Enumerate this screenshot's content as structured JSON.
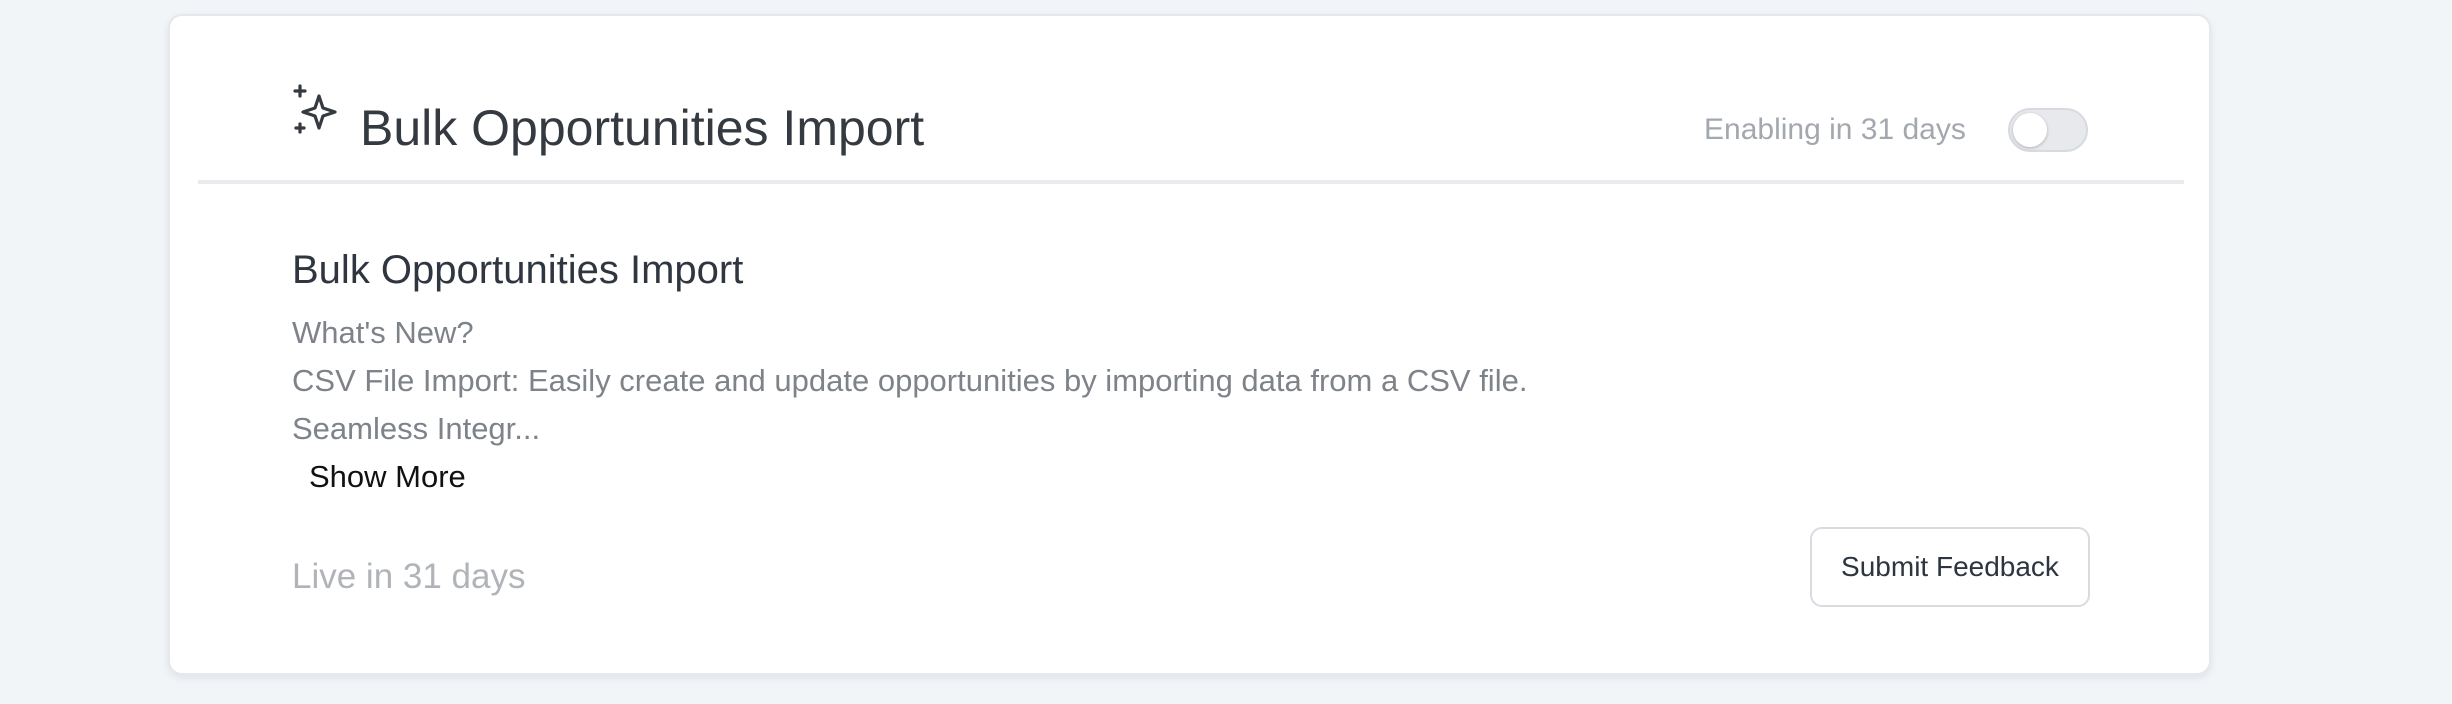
{
  "feature": {
    "header_title": "Bulk Opportunities Import",
    "icon": "sparkles-icon",
    "enable_status": "Enabling in 31 days",
    "toggle_enabled": false,
    "body_title": "Bulk Opportunities Import",
    "description_lines": [
      "What's New?",
      "CSV File Import: Easily create and update opportunities by importing data from a CSV file.",
      "Seamless Integr..."
    ],
    "show_more_label": "Show More",
    "live_status": "Live in 31 days",
    "feedback_button_label": "Submit Feedback"
  },
  "colors": {
    "background": "#f1f5f8",
    "card": "#ffffff",
    "title_text": "#343a40",
    "muted_text": "#7e838a",
    "faint_text": "#b0b4b9"
  }
}
